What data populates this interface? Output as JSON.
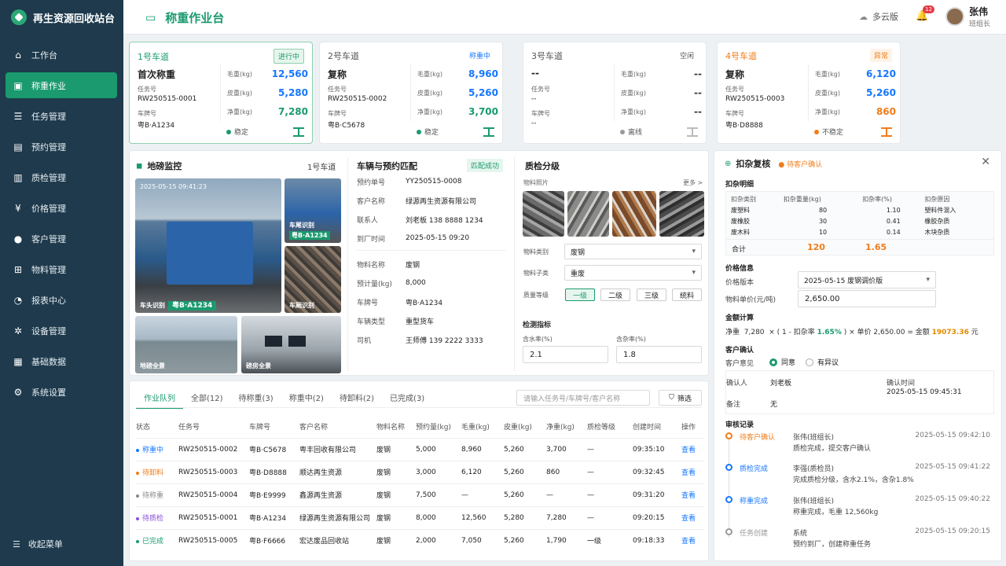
{
  "app": {
    "name": "再生资源回收站台"
  },
  "sidebar": {
    "items": [
      {
        "label": "工作台",
        "icon": "home-icon"
      },
      {
        "label": "称重作业",
        "icon": "scale-icon",
        "active": true
      },
      {
        "label": "任务管理",
        "icon": "task-icon"
      },
      {
        "label": "预约管理",
        "icon": "calendar-icon"
      },
      {
        "label": "质检管理",
        "icon": "inspection-icon"
      },
      {
        "label": "价格管理",
        "icon": "price-icon"
      },
      {
        "label": "客户管理",
        "icon": "users-icon"
      },
      {
        "label": "物料管理",
        "icon": "material-icon"
      },
      {
        "label": "报表中心",
        "icon": "report-icon"
      },
      {
        "label": "设备管理",
        "icon": "device-icon"
      },
      {
        "label": "基础数据",
        "icon": "data-icon"
      },
      {
        "label": "系统设置",
        "icon": "settings-icon"
      }
    ],
    "collapse": "收起菜单"
  },
  "header": {
    "title": "称重作业台",
    "cloud": "多云版",
    "notifications": "12",
    "user": {
      "name": "张伟",
      "role": "班组长"
    }
  },
  "lanes": [
    {
      "name": "1号车道",
      "status": "进行中",
      "status_color": "#1a9a6e",
      "name_color": "#1a9a6e",
      "stage": "首次称重",
      "task_label": "任务号",
      "task": "RW250515-0001",
      "plate_label": "车牌号",
      "plate": "粤B·A1234",
      "gross_label": "毛重(kg)",
      "gross": "12,560",
      "tare_label": "皮重(kg)",
      "tare": "5,280",
      "net_label": "净重(kg)",
      "net": "7,280",
      "state": "稳定",
      "state_color": "#1a9a6e"
    },
    {
      "name": "2号车道",
      "status": "称重中",
      "status_color": "#1677ff",
      "name_color": "#555",
      "stage": "复称",
      "task_label": "任务号",
      "task": "RW250515-0002",
      "plate_label": "车牌号",
      "plate": "粤B·C5678",
      "gross_label": "毛重(kg)",
      "gross": "8,960",
      "tare_label": "皮重(kg)",
      "tare": "5,260",
      "net_label": "净重(kg)",
      "net": "3,700",
      "state": "稳定",
      "state_color": "#1a9a6e"
    },
    {
      "name": "3号车道",
      "status": "空闲",
      "status_color": "#555",
      "name_color": "#555",
      "stage": "--",
      "task_label": "任务号",
      "task": "--",
      "plate_label": "车牌号",
      "plate": "--",
      "gross_label": "毛重(kg)",
      "gross": "--",
      "tare_label": "皮重(kg)",
      "tare": "--",
      "net_label": "净重(kg)",
      "net": "--",
      "state": "离线",
      "state_color": "#999"
    },
    {
      "name": "4号车道",
      "status": "异常",
      "status_color": "#f07c1a",
      "name_color": "#f07c1a",
      "stage": "复称",
      "task_label": "任务号",
      "task": "RW250515-0003",
      "plate_label": "车牌号",
      "plate": "粤B·D8888",
      "gross_label": "毛重(kg)",
      "gross": "6,120",
      "tare_label": "皮重(kg)",
      "tare": "5,260",
      "net_label": "净重(kg)",
      "net": "860",
      "state": "不稳定",
      "state_color": "#f07c1a"
    }
  ],
  "monitor": {
    "title": "地磅监控",
    "lane": "1号车道",
    "timestamp": "2025-05-15 09:41:23",
    "front_label": "车头识别",
    "front_plate": "粤B·A1234",
    "rear_label": "车尾识别",
    "rear_plate": "粤B·A1234",
    "cargo_label": "车厢识别",
    "overview_label": "地磅全景",
    "room_label": "磅房全景"
  },
  "match": {
    "title": "车辆与预约匹配",
    "badge": "匹配成功",
    "rows1": [
      {
        "k": "预约单号",
        "v": "YY250515-0008"
      },
      {
        "k": "客户名称",
        "v": "绿源再生资源有限公司"
      },
      {
        "k": "联系人",
        "v": "刘老板  138 8888 1234"
      },
      {
        "k": "到厂时间",
        "v": "2025-05-15 09:20"
      }
    ],
    "rows2": [
      {
        "k": "物料名称",
        "v": "废钢"
      },
      {
        "k": "预计量(kg)",
        "v": "8,000"
      },
      {
        "k": "车牌号",
        "v": "粤B·A1234"
      },
      {
        "k": "车辆类型",
        "v": "重型货车"
      },
      {
        "k": "司机",
        "v": "王师傅  139 2222 3333"
      }
    ]
  },
  "quality": {
    "title": "质检分级",
    "photos_label": "物料照片",
    "more": "更多 >",
    "type_label": "物料类别",
    "type": "废钢",
    "sub_label": "物料子类",
    "sub": "重废",
    "grade_label": "质量等级",
    "grades": [
      "一级",
      "二级",
      "三级",
      "统料"
    ],
    "metrics_title": "检测指标",
    "water_label": "含水率(%)",
    "water": "2.1",
    "impurity_label": "含杂率(%)",
    "impurity": "1.8"
  },
  "queue": {
    "tabs": [
      "作业队列",
      "全部(12)",
      "待称重(3)",
      "称重中(2)",
      "待卸料(2)",
      "已完成(3)"
    ],
    "search_placeholder": "请输入任务号/车牌号/客户名称",
    "filter": "筛选",
    "columns": [
      "状态",
      "任务号",
      "车牌号",
      "客户名称",
      "物料名称",
      "预约量(kg)",
      "毛重(kg)",
      "皮重(kg)",
      "净重(kg)",
      "质检等级",
      "创建时间",
      "操作"
    ],
    "rows": [
      {
        "status": "称重中",
        "color": "#1677ff",
        "cells": [
          "RW250515-0002",
          "粤B·C5678",
          "粤丰回收有限公司",
          "废钢",
          "5,000",
          "8,960",
          "5,260",
          "3,700",
          "—",
          "09:35:10",
          "查看"
        ]
      },
      {
        "status": "待卸料",
        "color": "#f07c1a",
        "cells": [
          "RW250515-0003",
          "粤B·D8888",
          "顺达再生资源",
          "废钢",
          "3,000",
          "6,120",
          "5,260",
          "860",
          "—",
          "09:32:45",
          "查看"
        ]
      },
      {
        "status": "待称重",
        "color": "#888",
        "cells": [
          "RW250515-0004",
          "粤B·E9999",
          "鑫源再生资源",
          "废钢",
          "7,500",
          "—",
          "5,260",
          "—",
          "—",
          "09:31:20",
          "查看"
        ]
      },
      {
        "status": "待质检",
        "color": "#8a4fd8",
        "cells": [
          "RW250515-0001",
          "粤B·A1234",
          "绿源再生资源有限公司",
          "废钢",
          "8,000",
          "12,560",
          "5,280",
          "7,280",
          "—",
          "09:20:15",
          "查看"
        ]
      },
      {
        "status": "已完成",
        "color": "#1a9a6e",
        "cells": [
          "RW250515-0005",
          "粤B·F6666",
          "宏达废品回收站",
          "废钢",
          "2,000",
          "7,050",
          "5,260",
          "1,790",
          "一级",
          "09:18:33",
          "查看"
        ]
      }
    ]
  },
  "review": {
    "title": "扣杂复核",
    "status": "待客户确认",
    "detail_title": "扣杂明细",
    "cols": [
      "扣杂类别",
      "扣杂重量(kg)",
      "扣杂率(%)",
      "扣杂原因"
    ],
    "rows": [
      [
        "废塑料",
        "80",
        "1.10",
        "塑料件混入"
      ],
      [
        "废橡胶",
        "30",
        "0.41",
        "橡胶杂质"
      ],
      [
        "废木料",
        "10",
        "0.14",
        "木块杂质"
      ]
    ],
    "total_label": "合计",
    "total_weight": "120",
    "total_rate": "1.65",
    "price_title": "价格信息",
    "price_version_label": "价格版本",
    "price_version": "2025-05-15 废钢调价版",
    "unit_price_label": "物料单价(元/吨)",
    "unit_price": "2,650.00",
    "calc_title": "金额计算",
    "calc": {
      "p1": "净重",
      "net": "7,280",
      "p2": "×  ( 1 - 扣杂率",
      "rate": "1.65%",
      "p3": ")  ×  单价",
      "price": "2,650.00",
      "p4": "=  金额",
      "amount": "19073.36",
      "unit": "元"
    },
    "confirm_title": "客户确认",
    "opinion_label": "客户意见",
    "agree": "同意",
    "object": "有异议",
    "confirmer_label": "确认人",
    "confirmer": "刘老板",
    "confirm_time_label": "确认时间",
    "confirm_time": "2025-05-15 09:45:31",
    "remark_label": "备注",
    "remark": "无",
    "log_title": "审核记录",
    "log": [
      {
        "title": "待客户确认",
        "who": "张伟(班组长)",
        "desc": "质检完成，提交客户确认",
        "time": "2025-05-15 09:42:10",
        "color": "#f07c1a"
      },
      {
        "title": "质检完成",
        "who": "李强(质检员)",
        "desc": "完成质检分级，含水2.1%，含杂1.8%",
        "time": "2025-05-15 09:41:22",
        "color": "#1677ff"
      },
      {
        "title": "称重完成",
        "who": "张伟(班组长)",
        "desc": "称重完成，毛重 12,560kg",
        "time": "2025-05-15 09:40:22",
        "color": "#1677ff"
      },
      {
        "title": "任务创建",
        "who": "系统",
        "desc": "预约到厂，创建称重任务",
        "time": "2025-05-15 09:20:15",
        "color": "#999"
      }
    ]
  }
}
